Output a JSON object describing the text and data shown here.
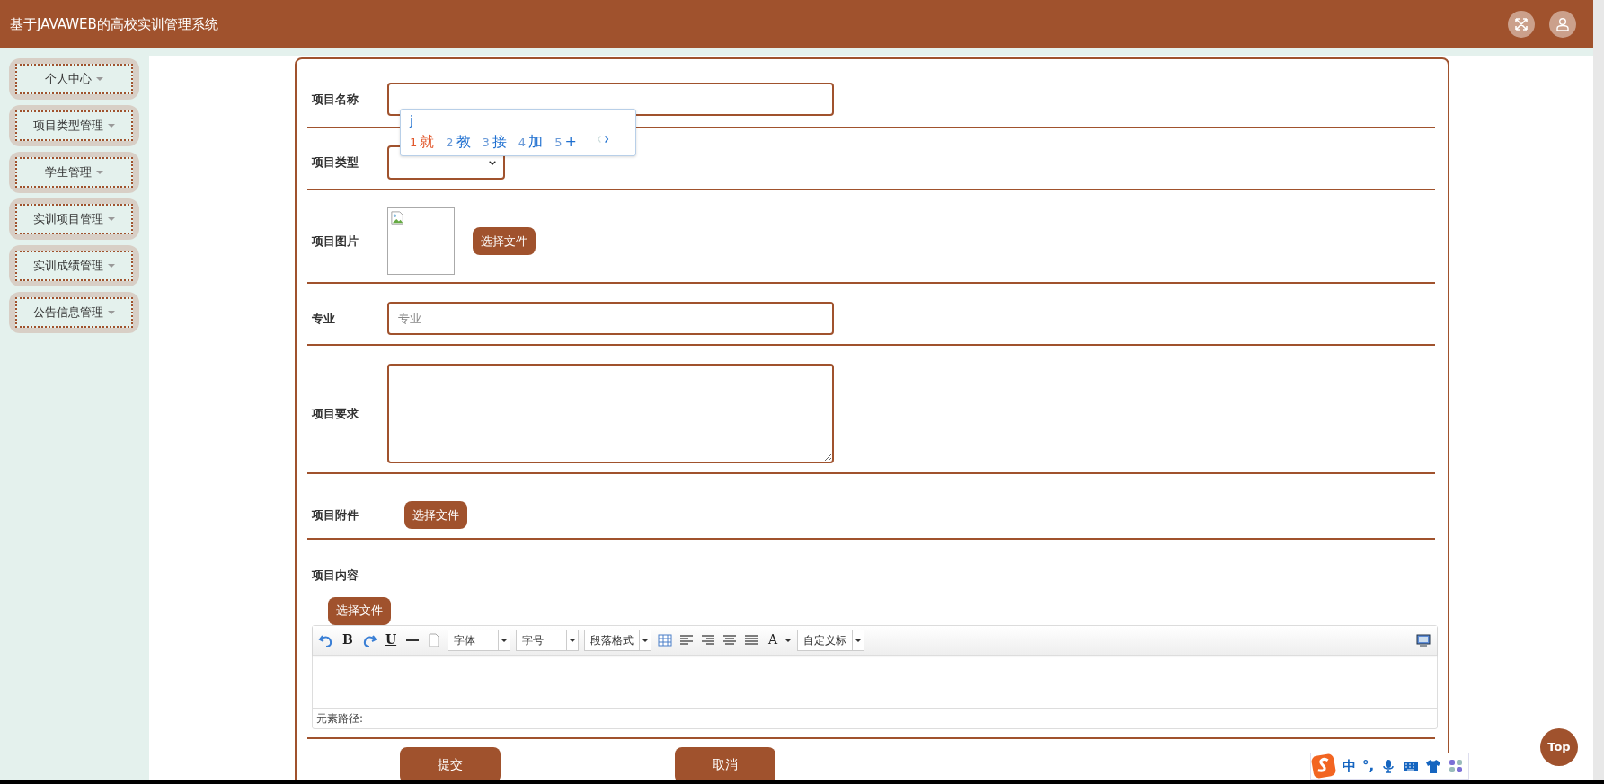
{
  "header": {
    "title": "基于JAVAWEB的高校实训管理系统"
  },
  "sidebar": {
    "items": [
      {
        "label": "个人中心"
      },
      {
        "label": "项目类型管理"
      },
      {
        "label": "学生管理"
      },
      {
        "label": "实训项目管理"
      },
      {
        "label": "实训成绩管理"
      },
      {
        "label": "公告信息管理"
      }
    ]
  },
  "form": {
    "fields": [
      {
        "kind": "text",
        "label": "项目名称"
      },
      {
        "kind": "select",
        "label": "项目类型"
      },
      {
        "kind": "image",
        "label": "项目图片",
        "button": "选择文件"
      },
      {
        "kind": "text",
        "label": "专业",
        "placeholder": "专业"
      },
      {
        "kind": "textarea",
        "label": "项目要求"
      },
      {
        "kind": "file",
        "label": "项目附件",
        "button": "选择文件"
      },
      {
        "kind": "editor",
        "label": "项目内容",
        "button": "选择文件",
        "path_label": "元素路径:"
      }
    ],
    "toolbar": [
      {
        "kind": "undo"
      },
      {
        "kind": "glyph",
        "text": "B"
      },
      {
        "kind": "redo"
      },
      {
        "kind": "glyph",
        "text": "U",
        "underline": true
      },
      {
        "kind": "rule"
      },
      {
        "kind": "page"
      },
      {
        "kind": "select",
        "text": "字体"
      },
      {
        "kind": "select",
        "text": "字号"
      },
      {
        "kind": "select",
        "text": "段落格式"
      },
      {
        "kind": "table"
      },
      {
        "kind": "align-left"
      },
      {
        "kind": "align-right"
      },
      {
        "kind": "align-center"
      },
      {
        "kind": "justify"
      },
      {
        "kind": "glyph-menu",
        "text": "A"
      },
      {
        "kind": "select",
        "text": "自定义标"
      }
    ],
    "buttons": [
      "提交",
      "取消"
    ]
  },
  "ime_popup": {
    "composition": "j",
    "candidates": [
      {
        "index": "1",
        "text": "就",
        "selected": true
      },
      {
        "index": "2",
        "text": "教",
        "selected": false
      },
      {
        "index": "3",
        "text": "接",
        "selected": false
      },
      {
        "index": "4",
        "text": "加",
        "selected": false
      },
      {
        "index": "5",
        "text": "+",
        "selected": false
      }
    ]
  },
  "ime_toolbar": {
    "mode": "中",
    "punctuation": "°,"
  },
  "top_button": "Top"
}
